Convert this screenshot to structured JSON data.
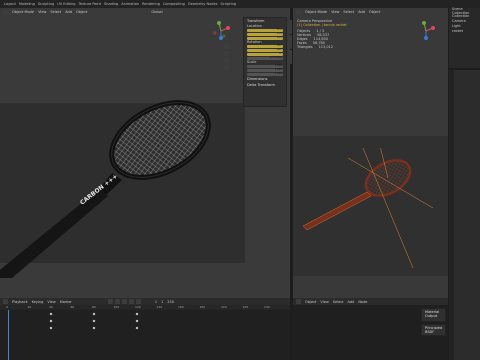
{
  "topbar": {
    "menu": [
      "Layout",
      "Modeling",
      "Sculpting",
      "UV Editing",
      "Texture Paint",
      "Shading",
      "Animation",
      "Rendering",
      "Compositing",
      "Geometry Nodes",
      "Scripting"
    ],
    "scene": "Scene",
    "view_layer": "ViewLayer"
  },
  "viewport_left": {
    "mode": "Object Mode",
    "menus": [
      "View",
      "Select",
      "Add",
      "Object"
    ],
    "shading": "Global",
    "racket_text": "CARBON +++"
  },
  "n_panel": {
    "transform_title": "Transform",
    "location_label": "Location",
    "location": [
      "0 m",
      "0 m",
      "0 m"
    ],
    "rotation_label": "Rotation",
    "rotation": [
      "-90°",
      "-90°",
      "0°"
    ],
    "mode": "XYZ Euler",
    "scale_label": "Scale",
    "scale": [
      "1.000",
      "1.000",
      "1.000"
    ],
    "dimensions": "Dimensions",
    "delta": "Delta Transform",
    "tabs": [
      "Item",
      "Tool",
      "View"
    ]
  },
  "viewport_right": {
    "mode": "Object Mode",
    "menus": [
      "View",
      "Select",
      "Add",
      "Object"
    ],
    "camera_name": "Camera Perspective",
    "collection": "(1) Collection | tennis racket",
    "stats": [
      {
        "k": "Objects",
        "v": "1 / 3"
      },
      {
        "k": "Vertices",
        "v": "58,337"
      },
      {
        "k": "Edges",
        "v": "114,650"
      },
      {
        "k": "Faces",
        "v": "56,780"
      },
      {
        "k": "Triangles",
        "v": "113,012"
      }
    ]
  },
  "outliner": {
    "title": "Scene Collection",
    "items": [
      "Collection",
      "Camera",
      "Light",
      "racket"
    ]
  },
  "timeline": {
    "menus": [
      "Playback",
      "Keying",
      "View",
      "Marker"
    ],
    "frames": [
      "0",
      "20",
      "40",
      "60",
      "80",
      "100",
      "120",
      "140",
      "160",
      "180",
      "200",
      "220",
      "240"
    ],
    "current_frame": "1",
    "start": "1",
    "end": "250"
  },
  "node_editor_bottom": {
    "mode": "Object",
    "menus": [
      "View",
      "Select",
      "Add",
      "Node"
    ],
    "nodes": [
      "Material Output",
      "Principled BSDF"
    ]
  },
  "colors": {
    "accent_yellow": "#b7a33a",
    "racket_red": "#8a3a28",
    "selection_orange": "#e08a2a"
  }
}
